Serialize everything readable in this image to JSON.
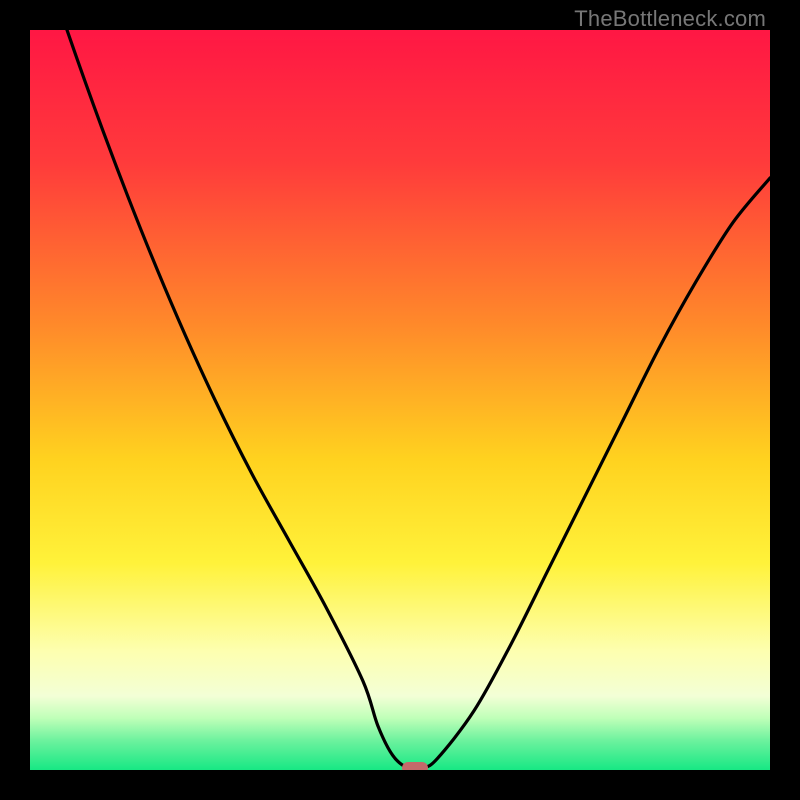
{
  "watermark": "TheBottleneck.com",
  "chart_data": {
    "type": "line",
    "title": "",
    "xlabel": "",
    "ylabel": "",
    "xlim": [
      0,
      100
    ],
    "ylim": [
      0,
      100
    ],
    "grid": false,
    "legend": false,
    "series": [
      {
        "name": "bottleneck-curve",
        "x": [
          0,
          5,
          10,
          15,
          20,
          25,
          30,
          35,
          40,
          45,
          47,
          49,
          51,
          53,
          55,
          60,
          65,
          70,
          75,
          80,
          85,
          90,
          95,
          100
        ],
        "y": [
          115,
          100,
          86,
          73,
          61,
          50,
          40,
          31,
          22,
          12,
          6,
          2,
          0.3,
          0.3,
          1.5,
          8,
          17,
          27,
          37,
          47,
          57,
          66,
          74,
          80
        ]
      }
    ],
    "marker": {
      "name": "optimal-point",
      "x": 52,
      "y": 0.3,
      "color": "#c46a6a"
    },
    "background_gradient": {
      "stops": [
        {
          "pos": 0.0,
          "color": "#ff1744"
        },
        {
          "pos": 0.18,
          "color": "#ff3b3b"
        },
        {
          "pos": 0.4,
          "color": "#ff8a2a"
        },
        {
          "pos": 0.58,
          "color": "#ffd21f"
        },
        {
          "pos": 0.72,
          "color": "#fff23a"
        },
        {
          "pos": 0.84,
          "color": "#fdffb0"
        },
        {
          "pos": 0.9,
          "color": "#f3ffd6"
        },
        {
          "pos": 0.93,
          "color": "#bfffb8"
        },
        {
          "pos": 0.96,
          "color": "#6df29e"
        },
        {
          "pos": 1.0,
          "color": "#17e884"
        }
      ]
    }
  }
}
